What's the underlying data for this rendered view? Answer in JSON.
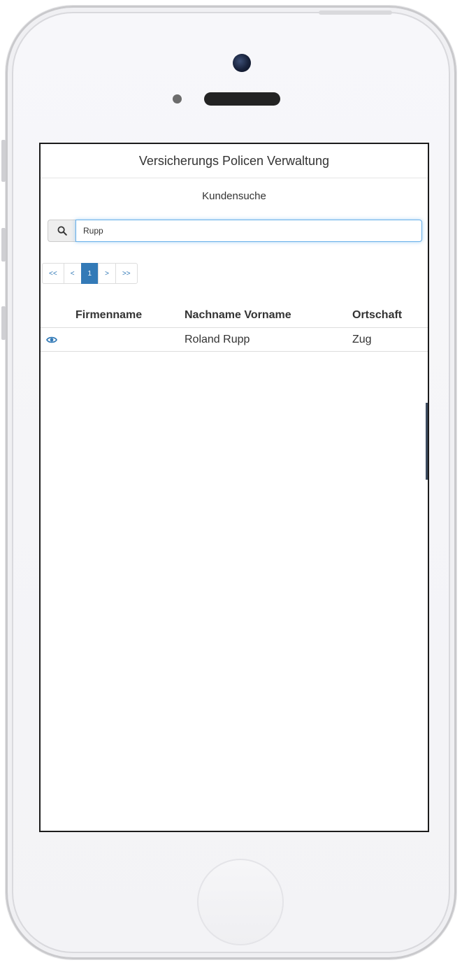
{
  "app": {
    "title": "Versicherungs Policen Verwaltung"
  },
  "page": {
    "title": "Kundensuche"
  },
  "search": {
    "icon": "search-icon",
    "value": "Rupp"
  },
  "pagination": {
    "items": [
      "<<",
      "<",
      "1",
      ">",
      ">>"
    ],
    "active_index": 2
  },
  "table": {
    "columns": [
      "",
      "Firmenname",
      "Nachname Vorname",
      "Ortschaft"
    ],
    "rows": [
      {
        "icon": "eye-icon",
        "firmenname": "",
        "name": "Roland Rupp",
        "ortschaft": "Zug"
      }
    ]
  },
  "colors": {
    "accent": "#337ab7",
    "focus_border": "#66afe9",
    "header_text": "#333333"
  }
}
